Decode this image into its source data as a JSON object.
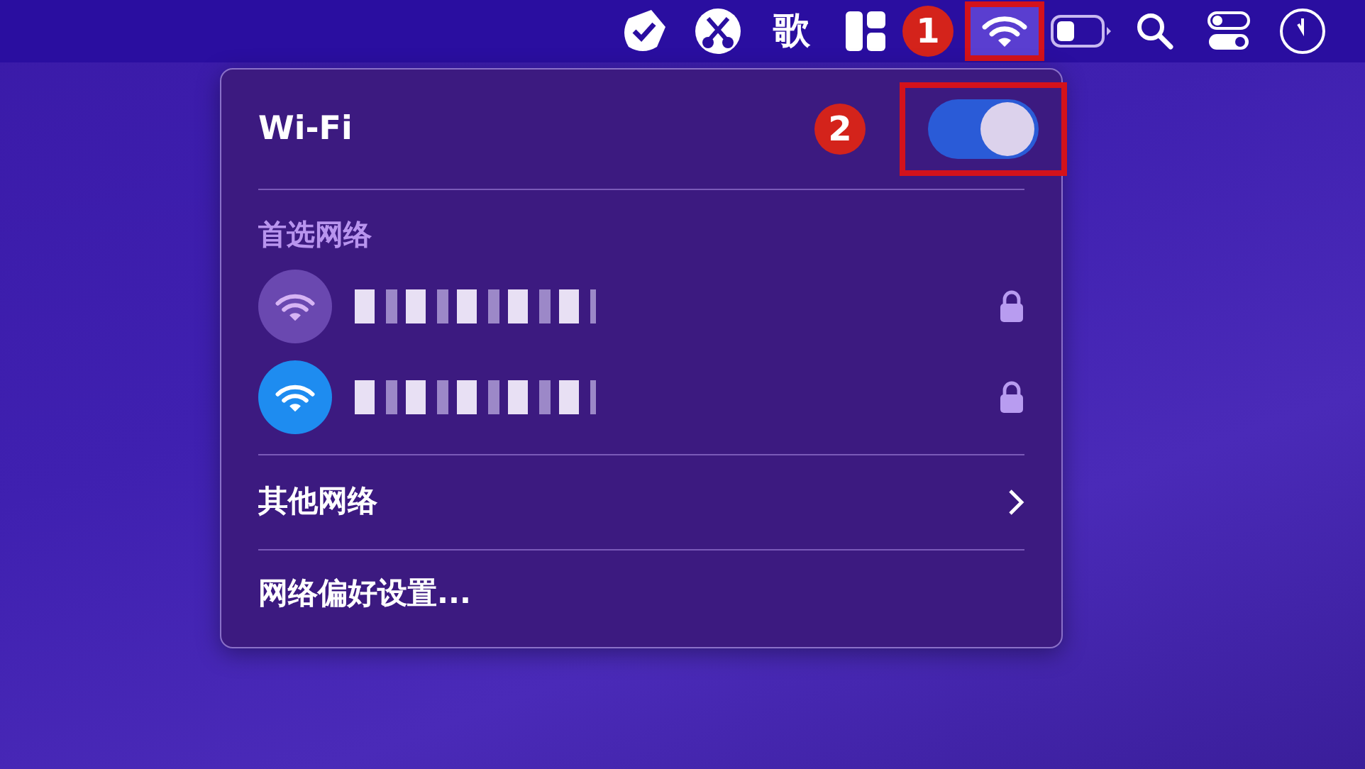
{
  "menu_bar": {
    "text_item": "歌",
    "wifi_highlighted": true,
    "annotation": "1"
  },
  "wifi_menu": {
    "title": "Wi-Fi",
    "annotation": "2",
    "wifi_on": true,
    "preferred_header": "首选网络",
    "networks": [
      {
        "connected": false,
        "locked": true
      },
      {
        "connected": true,
        "locked": true
      }
    ],
    "other_networks": "其他网络",
    "preferences": "网络偏好设置..."
  }
}
